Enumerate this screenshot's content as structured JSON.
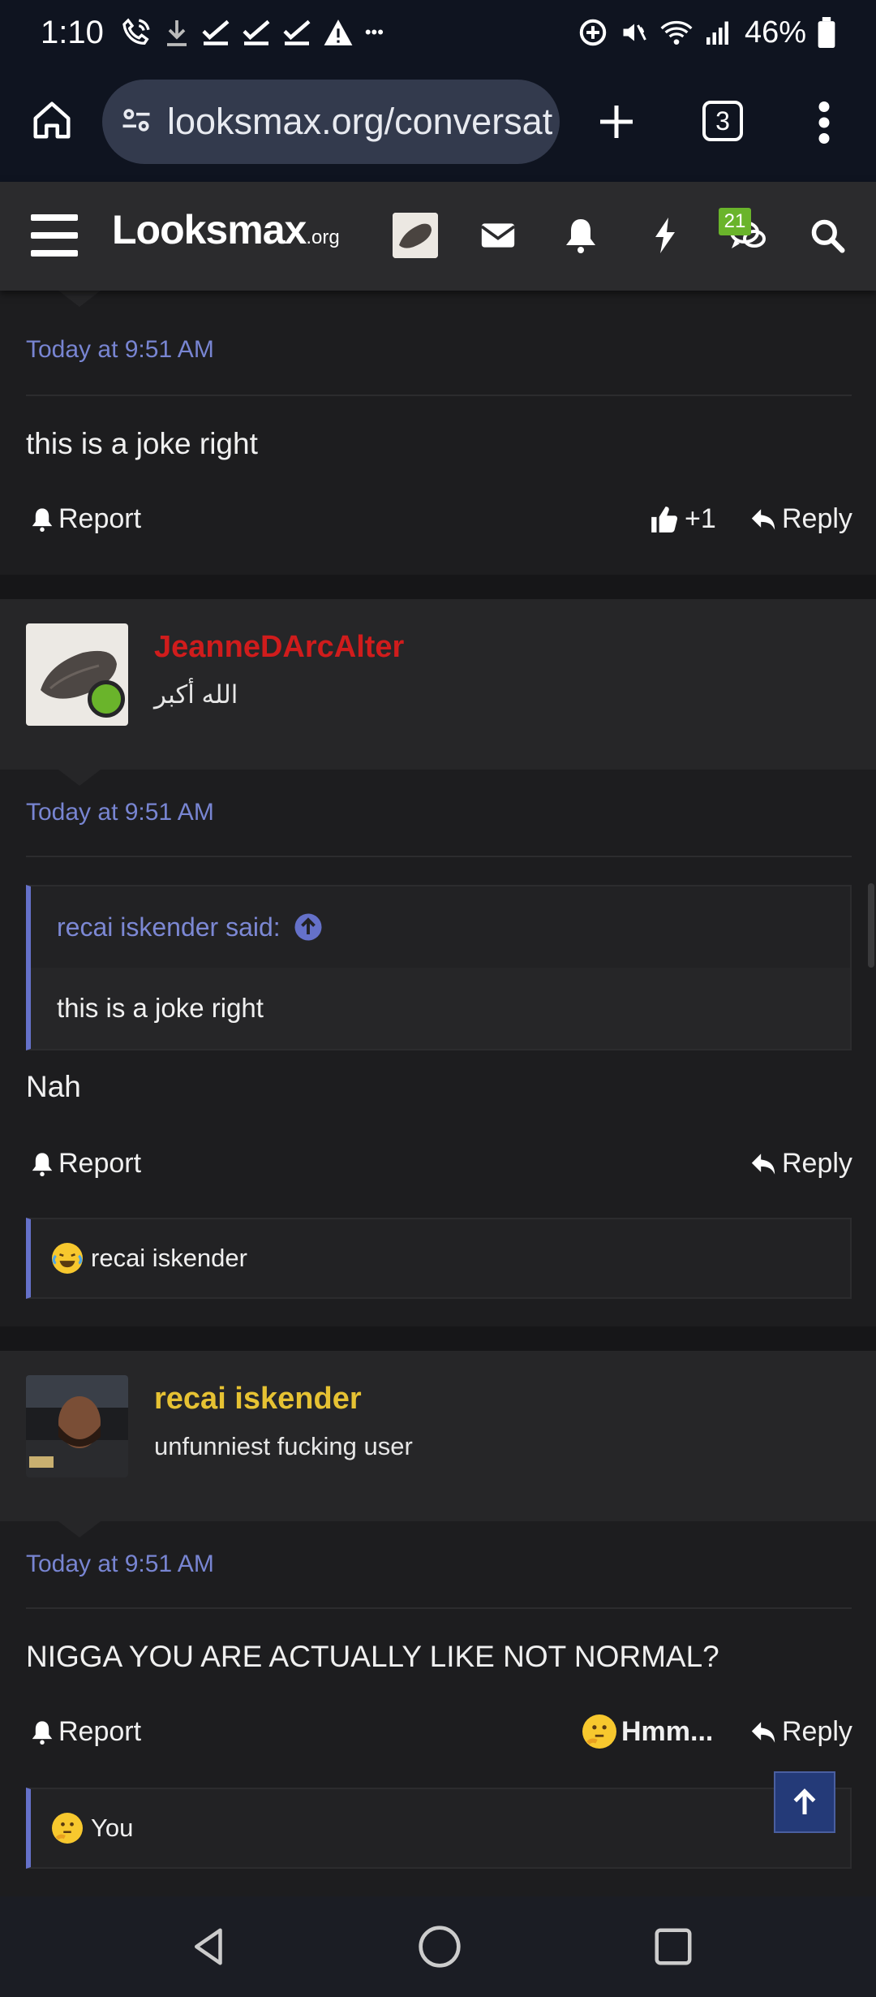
{
  "status_bar": {
    "time": "1:10",
    "battery": "46%"
  },
  "browser": {
    "url": "looksmax.org/conversat",
    "tab_count": "3"
  },
  "site": {
    "logo": "Lᴏᴏksmax",
    "logo_suffix": ".org",
    "notification_badge": "21"
  },
  "thread": {
    "post1": {
      "timestamp": "Today at 9:51 AM",
      "text": "this is a joke right",
      "report": "Report",
      "like_count": "+1",
      "reply": "Reply"
    },
    "post2": {
      "username": "JeanneDArcAlter",
      "username_color": "#d01c1c",
      "user_title": "الله أكبر",
      "timestamp": "Today at 9:51 AM",
      "quote_author": "recai iskender said:",
      "quote_text": "this is a joke right",
      "text": "Nah",
      "report": "Report",
      "reply": "Reply",
      "reaction_user": "recai iskender"
    },
    "post3": {
      "username": "recai iskender",
      "username_color": "#e6c233",
      "user_title": "unfunniest fucking user",
      "timestamp": "Today at 9:51 AM",
      "text": "NIGGA YOU ARE ACTUALLY LIKE NOT NORMAL?",
      "report": "Report",
      "reaction_label": "Hmm...",
      "reply": "Reply",
      "reaction_user": "You"
    }
  },
  "colors": {
    "accent": "#7885d2",
    "online": "#6ab42b",
    "background": "#1d1d1f"
  }
}
